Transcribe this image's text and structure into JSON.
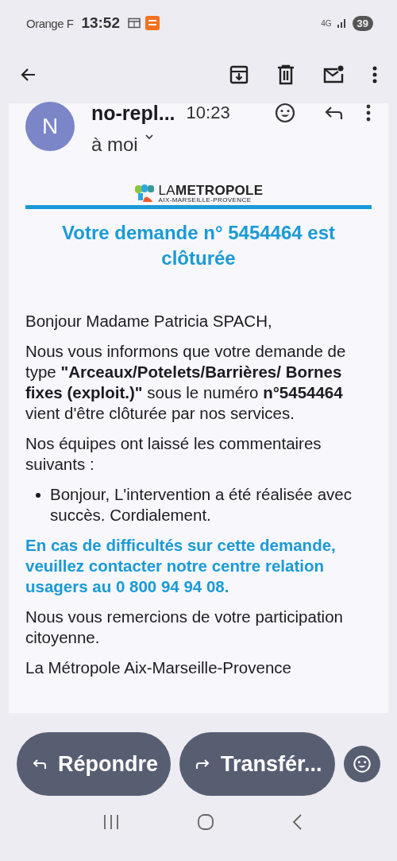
{
  "status_bar": {
    "carrier": "Orange F",
    "time": "13:52",
    "network": "4G",
    "battery": "39"
  },
  "message": {
    "avatar_letter": "N",
    "sender": "no-repl...",
    "time": "10:23",
    "recipient": "à moi"
  },
  "logo": {
    "light": "LA",
    "bold": "METROPOLE",
    "subtitle": "AIX-MARSEILLE-PROVENCE"
  },
  "heading": "Votre demande n° 5454464 est clôturée",
  "body": [
    {
      "kind": "paragraph",
      "text": "Bonjour Madame Patricia SPACH,"
    },
    {
      "kind": "paragraph",
      "text": "Nous vous informons que votre demande de type **\"Arceaux/Potelets/Barrières/ Bornes fixes (exploit.)\"** sous le numéro **n°5454464** vient d'être clôturée par nos services."
    },
    {
      "kind": "paragraph",
      "text": "Nos équipes ont laissé les commentaires suivants :"
    },
    {
      "kind": "bullet",
      "text": "Bonjour, L'intervention a été réalisée avec succès. Cordialement."
    },
    {
      "kind": "notice",
      "text": "En cas de difficultés sur cette demande, veuillez contacter notre centre relation usagers au 0 800 94 94 08."
    },
    {
      "kind": "paragraph",
      "text": "Nous vous remercions de votre participation citoyenne."
    },
    {
      "kind": "paragraph",
      "text": "La Métropole Aix-Marseille-Provence"
    }
  ],
  "actions": [
    {
      "kind": "reply",
      "label": "Répondre"
    },
    {
      "kind": "forward",
      "label": "Transfér..."
    }
  ]
}
